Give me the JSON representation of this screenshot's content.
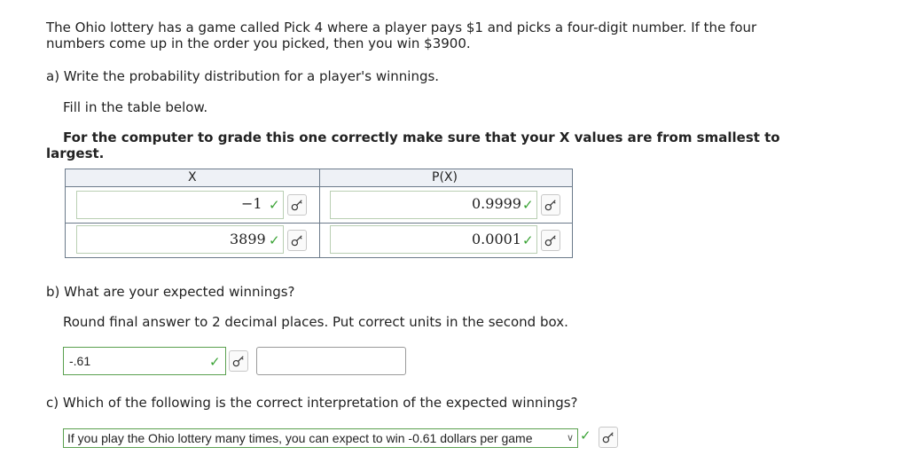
{
  "question": {
    "intro_line1": "The Ohio lottery has a game called Pick 4 where a player pays $1 and picks a four-digit number. If the four",
    "intro_line2": "numbers come up in the order you picked, then you win $3900."
  },
  "part_a": {
    "prompt": "a) Write the probability distribution for a player's winnings.",
    "instruction": "Fill in the table below.",
    "note_line1": "For the computer to grade this one correctly make sure that your X values are from smallest to",
    "note_line2": "largest.",
    "table": {
      "headers": [
        "X",
        "P(X)"
      ],
      "rows": [
        {
          "x": "−1",
          "p": "0.9999"
        },
        {
          "x": "3899",
          "p": "0.0001"
        }
      ]
    }
  },
  "part_b": {
    "prompt": "b) What are your expected winnings?",
    "instruction": "Round final answer to 2 decimal places. Put correct units in the second box.",
    "answer_value": "-.61",
    "units_value": ""
  },
  "part_c": {
    "prompt": "c) Which of the following is the correct interpretation of the expected winnings?",
    "selected_option": "If you play the Ohio lottery many times, you can expect to win -0.61 dollars per game"
  },
  "icons": {
    "check": "✓",
    "key": "key-icon",
    "chevron": "∨"
  },
  "colors": {
    "check_green": "#3aa335",
    "correct_border": "#5aa04f",
    "table_header_bg": "#eef1f6"
  }
}
